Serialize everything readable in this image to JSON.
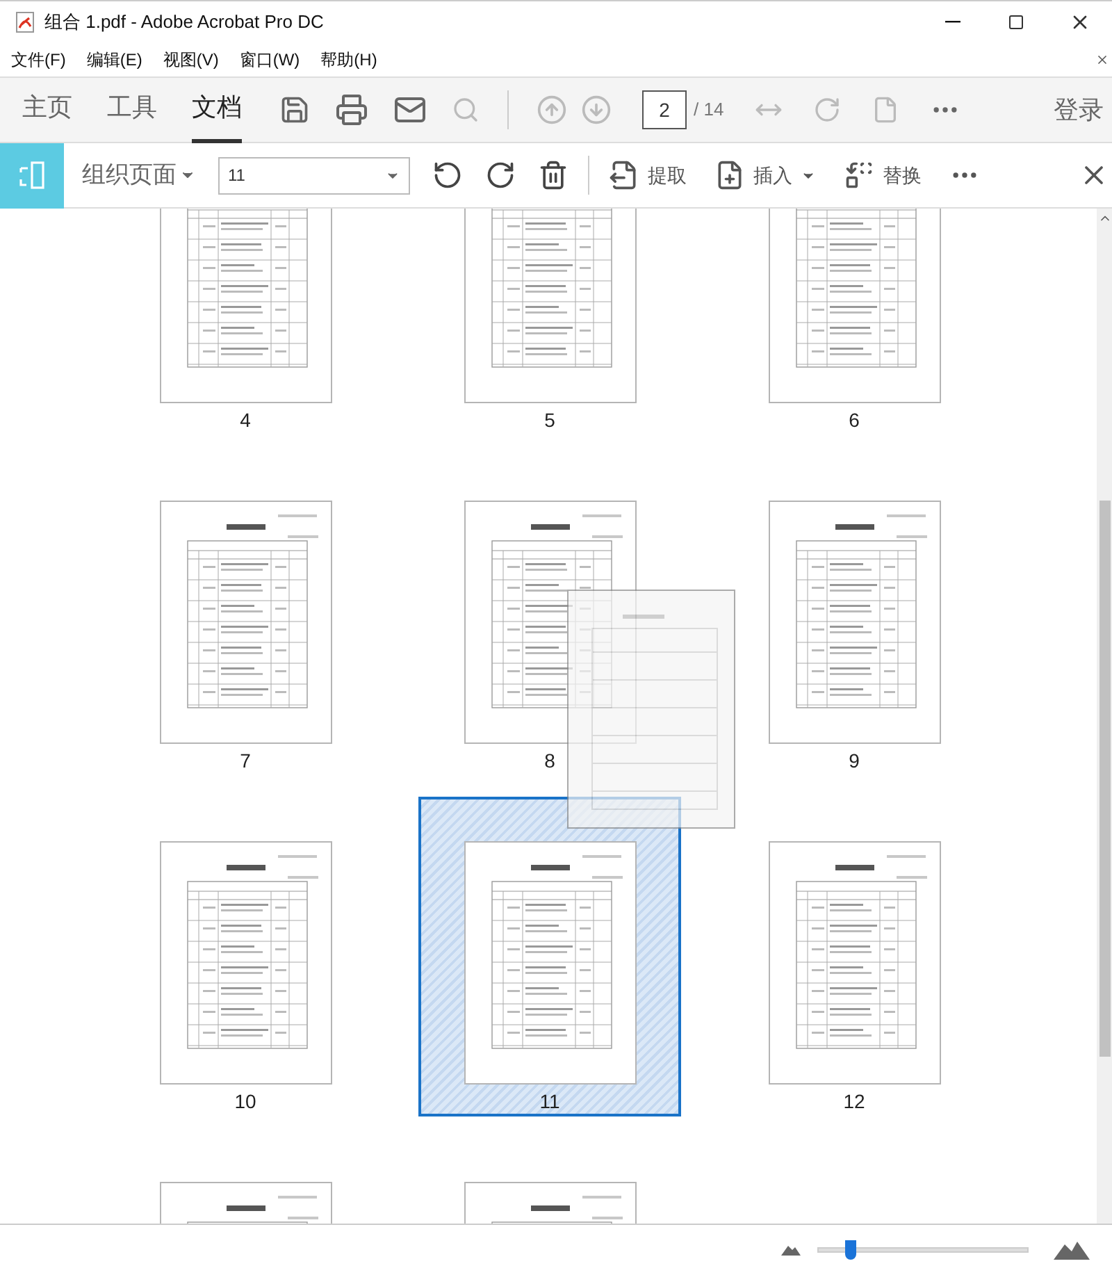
{
  "window": {
    "title": "组合 1.pdf - Adobe Acrobat Pro DC"
  },
  "menu": [
    "文件(F)",
    "编辑(E)",
    "视图(V)",
    "窗口(W)",
    "帮助(H)"
  ],
  "tabs": [
    {
      "label": "主页",
      "selected": false
    },
    {
      "label": "工具",
      "selected": false
    },
    {
      "label": "文档",
      "selected": true
    }
  ],
  "page_nav": {
    "value": "2",
    "total": "/ 14"
  },
  "sign_in": "登录",
  "organize_bar": {
    "title": "组织页面",
    "page_range": "11",
    "actions": [
      {
        "kind": "extract",
        "label": "提取",
        "menu": false
      },
      {
        "kind": "insert",
        "label": "插入",
        "menu": true
      },
      {
        "kind": "replace",
        "label": "替换",
        "menu": false
      }
    ]
  },
  "pages": [
    {
      "label": "4",
      "selected": false
    },
    {
      "label": "5",
      "selected": false
    },
    {
      "label": "6",
      "selected": false
    },
    {
      "label": "7",
      "selected": false
    },
    {
      "label": "8",
      "selected": false
    },
    {
      "label": "9",
      "selected": false
    },
    {
      "label": "10",
      "selected": false
    },
    {
      "label": "11",
      "selected": true
    },
    {
      "label": "12",
      "selected": false
    },
    {
      "selected": false
    },
    {
      "selected": false
    }
  ],
  "zoom": {
    "level": 0.16
  }
}
